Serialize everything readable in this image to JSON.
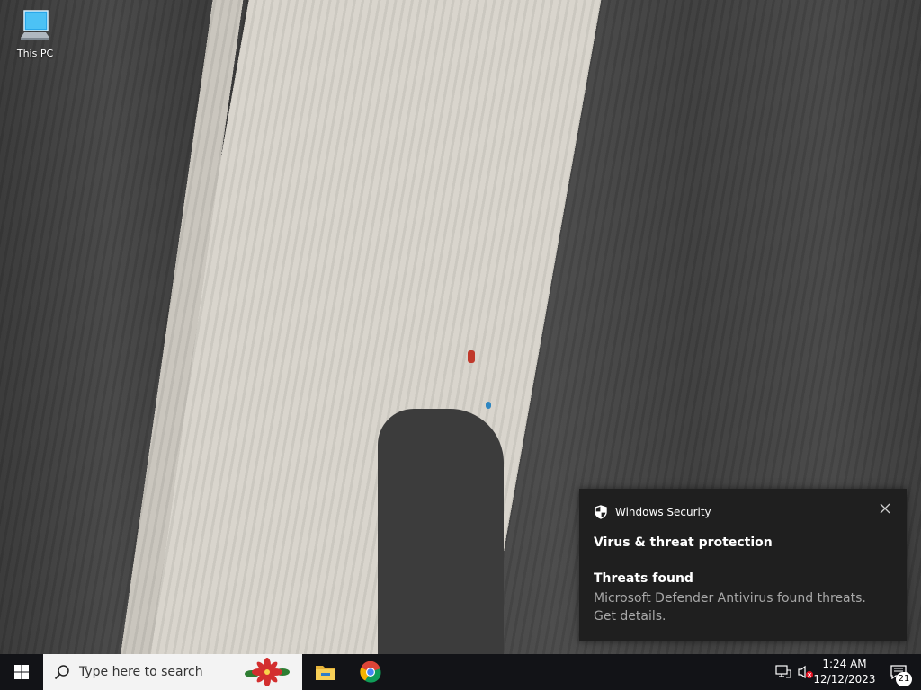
{
  "desktop": {
    "icons": [
      {
        "label": "This PC",
        "icon": "computer-icon"
      }
    ]
  },
  "toast": {
    "app_name": "Windows Security",
    "app_icon": "shield-icon",
    "title": "Virus & threat protection",
    "subtitle": "Threats found",
    "body": "Microsoft Defender Antivirus found threats. Get details."
  },
  "taskbar": {
    "start_icon": "windows-logo-icon",
    "search_placeholder": "Type here to search",
    "apps": [
      {
        "icon": "file-explorer-icon"
      },
      {
        "icon": "chrome-icon"
      }
    ],
    "tray": {
      "network_icon": "network-icon",
      "volume_icon": "volume-muted-icon"
    },
    "clock": {
      "time": "1:24 AM",
      "date": "12/12/2023"
    },
    "notifications": {
      "count": "21",
      "icon": "action-center-icon"
    }
  }
}
